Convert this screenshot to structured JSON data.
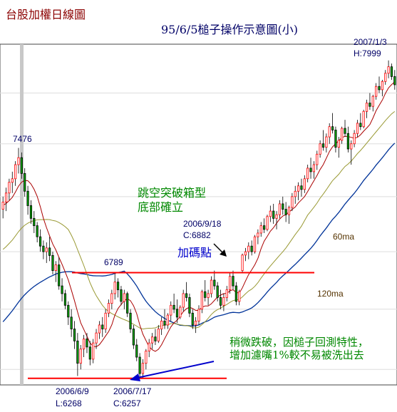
{
  "title": "台股加權日線圖",
  "subtitle": "95/6/5槌子操作示意圖(小)",
  "chart_data": {
    "type": "candlestick",
    "title": "台股加權日線圖",
    "subtitle": "95/6/5槌子操作示意圖(小)",
    "yscale": "log",
    "ylim": [
      6225,
      8100
    ],
    "colors": {
      "up": "#ff0000",
      "down": "#00aa00",
      "ma20": "#aa0000",
      "ma60": "#999933",
      "ma120": "#003399",
      "support_line": "#ff0000",
      "arrow": "#0000cc",
      "text_green": "#008800",
      "text_blue": "#0000cc",
      "annotation": "#000066",
      "title": "#8b0000"
    },
    "key_points": {
      "high_may": 7476,
      "low_jun": {
        "date": "2006/6/9",
        "label": "L:6268",
        "value": 6268
      },
      "close_jul": {
        "date": "2006/7/17",
        "label": "C:6257",
        "value": 6257
      },
      "sep18": {
        "date": "2006/9/18",
        "label": "C:6882",
        "value": 6882
      },
      "box_top": 6789,
      "high_jan": {
        "date": "2007/1/3",
        "label": "H:7999",
        "value": 7999
      }
    },
    "hlines": [
      {
        "name": "box-top",
        "value": 6789
      },
      {
        "name": "bottom-support",
        "value": 6257
      }
    ],
    "moving_average_labels": [
      "60ma",
      "120ma"
    ],
    "annotations": [
      {
        "id": "breakout",
        "lines": [
          "跳空突破箱型",
          "底部確立"
        ]
      },
      {
        "id": "add",
        "text": "加碼點"
      },
      {
        "id": "note",
        "lines": [
          "稍微跌破，因槌子回測特性，",
          "增加濾嘴1%較不易被洗出去"
        ]
      }
    ],
    "candles": [
      [
        7130,
        7200,
        7080,
        7170
      ],
      [
        7170,
        7250,
        7120,
        7220
      ],
      [
        7220,
        7300,
        7180,
        7280
      ],
      [
        7280,
        7340,
        7220,
        7300
      ],
      [
        7300,
        7400,
        7260,
        7380
      ],
      [
        7380,
        7476,
        7330,
        7420
      ],
      [
        7420,
        7450,
        7300,
        7330
      ],
      [
        7330,
        7360,
        7200,
        7230
      ],
      [
        7230,
        7260,
        7100,
        7150
      ],
      [
        7150,
        7180,
        7050,
        7080
      ],
      [
        7080,
        7120,
        7000,
        7040
      ],
      [
        7040,
        7060,
        6950,
        6980
      ],
      [
        6980,
        7020,
        6900,
        6930
      ],
      [
        6930,
        6960,
        6860,
        6900
      ],
      [
        6900,
        6950,
        6840,
        6920
      ],
      [
        6920,
        6980,
        6850,
        6880
      ],
      [
        6880,
        6900,
        6780,
        6800
      ],
      [
        6800,
        6850,
        6740,
        6830
      ],
      [
        6830,
        6870,
        6700,
        6720
      ],
      [
        6720,
        6760,
        6640,
        6680
      ],
      [
        6680,
        6700,
        6600,
        6620
      ],
      [
        6620,
        6640,
        6520,
        6560
      ],
      [
        6560,
        6600,
        6460,
        6500
      ],
      [
        6500,
        6540,
        6400,
        6440
      ],
      [
        6440,
        6480,
        6268,
        6330
      ],
      [
        6330,
        6420,
        6300,
        6400
      ],
      [
        6400,
        6470,
        6360,
        6450
      ],
      [
        6450,
        6480,
        6380,
        6410
      ],
      [
        6410,
        6440,
        6320,
        6350
      ],
      [
        6350,
        6450,
        6330,
        6430
      ],
      [
        6430,
        6500,
        6400,
        6480
      ],
      [
        6480,
        6540,
        6450,
        6520
      ],
      [
        6520,
        6560,
        6460,
        6500
      ],
      [
        6500,
        6600,
        6480,
        6580
      ],
      [
        6580,
        6650,
        6560,
        6630
      ],
      [
        6630,
        6700,
        6600,
        6680
      ],
      [
        6680,
        6789,
        6650,
        6740
      ],
      [
        6740,
        6760,
        6660,
        6700
      ],
      [
        6700,
        6720,
        6620,
        6640
      ],
      [
        6640,
        6700,
        6600,
        6680
      ],
      [
        6680,
        6690,
        6560,
        6580
      ],
      [
        6580,
        6600,
        6480,
        6500
      ],
      [
        6500,
        6520,
        6400,
        6420
      ],
      [
        6420,
        6450,
        6340,
        6360
      ],
      [
        6360,
        6380,
        6257,
        6280
      ],
      [
        6280,
        6350,
        6257,
        6330
      ],
      [
        6330,
        6400,
        6300,
        6390
      ],
      [
        6390,
        6450,
        6360,
        6430
      ],
      [
        6430,
        6480,
        6400,
        6460
      ],
      [
        6460,
        6500,
        6420,
        6440
      ],
      [
        6440,
        6520,
        6430,
        6500
      ],
      [
        6500,
        6560,
        6470,
        6540
      ],
      [
        6540,
        6600,
        6500,
        6520
      ],
      [
        6520,
        6580,
        6500,
        6570
      ],
      [
        6570,
        6640,
        6540,
        6620
      ],
      [
        6620,
        6680,
        6580,
        6600
      ],
      [
        6600,
        6650,
        6530,
        6560
      ],
      [
        6560,
        6620,
        6550,
        6610
      ],
      [
        6610,
        6700,
        6590,
        6680
      ],
      [
        6680,
        6740,
        6640,
        6660
      ],
      [
        6660,
        6680,
        6560,
        6580
      ],
      [
        6580,
        6600,
        6500,
        6520
      ],
      [
        6520,
        6560,
        6480,
        6540
      ],
      [
        6540,
        6620,
        6520,
        6600
      ],
      [
        6600,
        6700,
        6580,
        6690
      ],
      [
        6690,
        6750,
        6640,
        6660
      ],
      [
        6660,
        6700,
        6620,
        6680
      ],
      [
        6680,
        6770,
        6660,
        6750
      ],
      [
        6750,
        6800,
        6700,
        6720
      ],
      [
        6720,
        6740,
        6640,
        6660
      ],
      [
        6660,
        6700,
        6600,
        6620
      ],
      [
        6620,
        6680,
        6590,
        6660
      ],
      [
        6660,
        6720,
        6640,
        6700
      ],
      [
        6700,
        6790,
        6680,
        6770
      ],
      [
        6770,
        6800,
        6700,
        6720
      ],
      [
        6720,
        6740,
        6620,
        6640
      ],
      [
        6640,
        6700,
        6620,
        6690
      ],
      [
        6800,
        6890,
        6790,
        6882
      ],
      [
        6882,
        6920,
        6850,
        6900
      ],
      [
        6900,
        6950,
        6860,
        6930
      ],
      [
        6930,
        6960,
        6880,
        6900
      ],
      [
        6900,
        6990,
        6890,
        6980
      ],
      [
        6980,
        7020,
        6940,
        7000
      ],
      [
        7000,
        7060,
        6980,
        7040
      ],
      [
        7040,
        7080,
        7000,
        7020
      ],
      [
        7020,
        7100,
        7010,
        7090
      ],
      [
        7090,
        7150,
        7060,
        7120
      ],
      [
        7120,
        7160,
        7050,
        7080
      ],
      [
        7080,
        7120,
        7020,
        7100
      ],
      [
        7100,
        7180,
        7080,
        7160
      ],
      [
        7160,
        7200,
        7100,
        7130
      ],
      [
        7130,
        7170,
        7060,
        7100
      ],
      [
        7100,
        7150,
        7050,
        7140
      ],
      [
        7140,
        7220,
        7120,
        7200
      ],
      [
        7200,
        7260,
        7160,
        7230
      ],
      [
        7230,
        7280,
        7180,
        7260
      ],
      [
        7260,
        7300,
        7200,
        7240
      ],
      [
        7240,
        7320,
        7220,
        7300
      ],
      [
        7300,
        7380,
        7280,
        7360
      ],
      [
        7360,
        7420,
        7300,
        7340
      ],
      [
        7340,
        7400,
        7300,
        7380
      ],
      [
        7380,
        7460,
        7350,
        7440
      ],
      [
        7440,
        7520,
        7420,
        7500
      ],
      [
        7500,
        7580,
        7460,
        7480
      ],
      [
        7480,
        7560,
        7450,
        7540
      ],
      [
        7540,
        7620,
        7500,
        7600
      ],
      [
        7600,
        7680,
        7560,
        7580
      ],
      [
        7580,
        7600,
        7450,
        7480
      ],
      [
        7480,
        7540,
        7420,
        7520
      ],
      [
        7520,
        7600,
        7500,
        7590
      ],
      [
        7590,
        7640,
        7540,
        7560
      ],
      [
        7560,
        7600,
        7450,
        7470
      ],
      [
        7470,
        7520,
        7380,
        7500
      ],
      [
        7500,
        7580,
        7480,
        7560
      ],
      [
        7560,
        7640,
        7540,
        7620
      ],
      [
        7620,
        7680,
        7580,
        7600
      ],
      [
        7600,
        7700,
        7590,
        7690
      ],
      [
        7690,
        7760,
        7650,
        7740
      ],
      [
        7740,
        7800,
        7700,
        7720
      ],
      [
        7720,
        7790,
        7690,
        7780
      ],
      [
        7780,
        7860,
        7760,
        7840
      ],
      [
        7840,
        7900,
        7800,
        7820
      ],
      [
        7820,
        7880,
        7780,
        7870
      ],
      [
        7870,
        7940,
        7850,
        7920
      ],
      [
        7920,
        7999,
        7890,
        7960
      ],
      [
        7960,
        7980,
        7880,
        7900
      ],
      [
        7900,
        7940,
        7820,
        7850
      ]
    ]
  }
}
